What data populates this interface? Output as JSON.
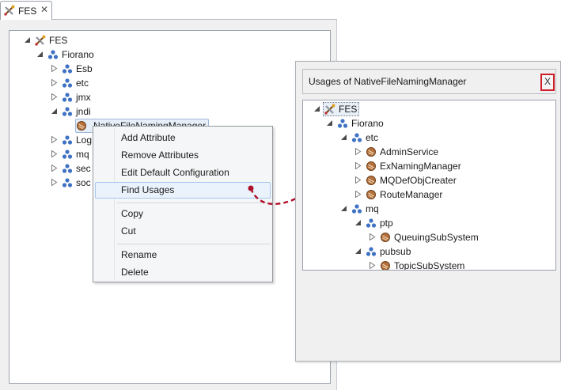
{
  "tab": {
    "label": "FES",
    "close": "✕"
  },
  "left_tree": {
    "root": "FES",
    "fiorano": "Fiorano",
    "children": [
      "Esb",
      "etc",
      "jmx",
      "jndi"
    ],
    "jndi_child": "NativeFileNamingManager",
    "partial_children": [
      "Log",
      "mq",
      "sec",
      "soc"
    ]
  },
  "context_menu": {
    "items": [
      "Add Attribute",
      "Remove Attributes",
      "Edit Default Configuration",
      "Find Usages"
    ],
    "edit_items": [
      "Copy",
      "Cut"
    ],
    "manage_items": [
      "Rename",
      "Delete"
    ],
    "highlighted": "Find Usages"
  },
  "usages_dialog": {
    "title": "Usages of NativeFileNamingManager",
    "close_label": "X",
    "tree": {
      "root": "FES",
      "fiorano": "Fiorano",
      "etc": "etc",
      "etc_children": [
        "AdminService",
        "ExNamingManager",
        "MQDefObjCreater",
        "RouteManager"
      ],
      "mq": "mq",
      "ptp": "ptp",
      "ptp_child": "QueuingSubSystem",
      "pubsub": "pubsub",
      "pubsub_child": "TopicSubSystem"
    }
  },
  "colors": {
    "selection_border": "#cc1f2a",
    "arrow": "#b0102a",
    "menu_highlight": "#eaf2fb"
  }
}
